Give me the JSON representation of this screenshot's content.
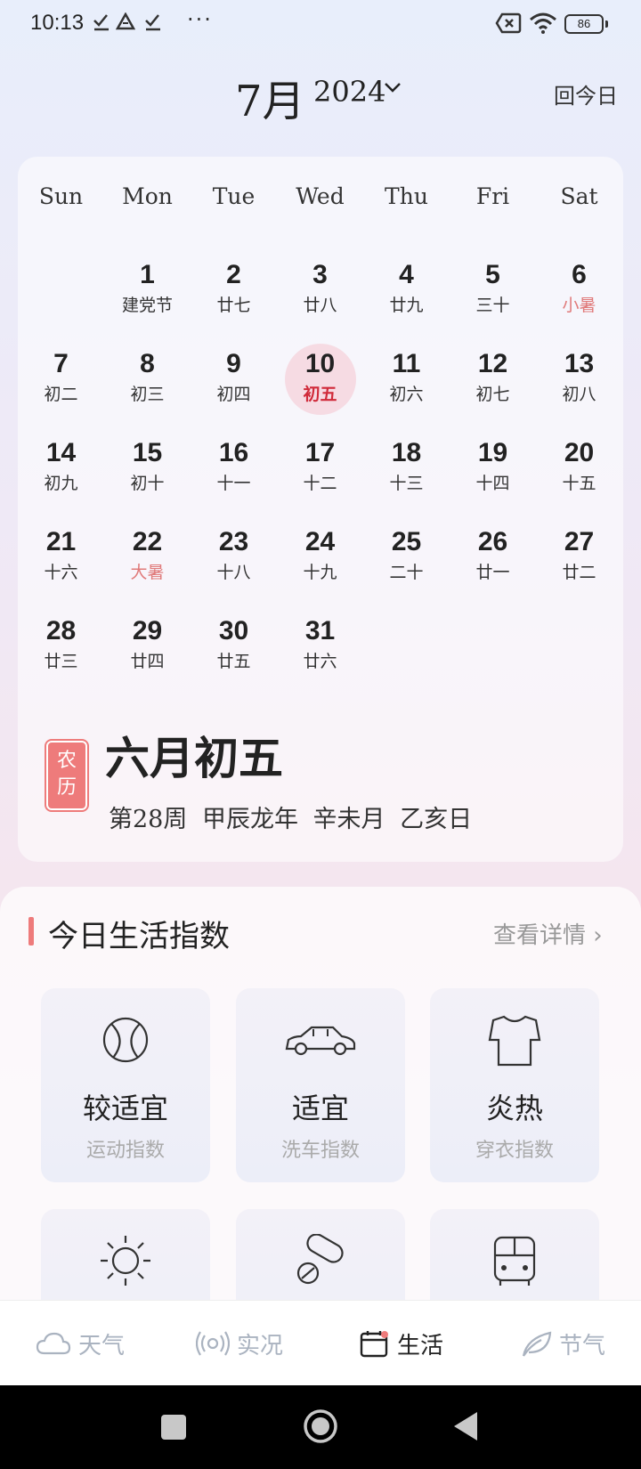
{
  "status": {
    "time": "10:13",
    "battery": "86"
  },
  "header": {
    "month": "7月",
    "year": "2024",
    "today_button": "回今日"
  },
  "calendar": {
    "weekdays": [
      "Sun",
      "Mon",
      "Tue",
      "Wed",
      "Thu",
      "Fri",
      "Sat"
    ],
    "weeks": [
      [
        null,
        {
          "day": "1",
          "lunar": "建党节",
          "festival": false
        },
        {
          "day": "2",
          "lunar": "廿七",
          "festival": false
        },
        {
          "day": "3",
          "lunar": "廿八",
          "festival": false
        },
        {
          "day": "4",
          "lunar": "廿九",
          "festival": false
        },
        {
          "day": "5",
          "lunar": "三十",
          "festival": false
        },
        {
          "day": "6",
          "lunar": "小暑",
          "festival": true
        }
      ],
      [
        {
          "day": "7",
          "lunar": "初二",
          "festival": false
        },
        {
          "day": "8",
          "lunar": "初三",
          "festival": false
        },
        {
          "day": "9",
          "lunar": "初四",
          "festival": false
        },
        {
          "day": "10",
          "lunar": "初五",
          "festival": false,
          "today": true
        },
        {
          "day": "11",
          "lunar": "初六",
          "festival": false
        },
        {
          "day": "12",
          "lunar": "初七",
          "festival": false
        },
        {
          "day": "13",
          "lunar": "初八",
          "festival": false
        }
      ],
      [
        {
          "day": "14",
          "lunar": "初九",
          "festival": false
        },
        {
          "day": "15",
          "lunar": "初十",
          "festival": false
        },
        {
          "day": "16",
          "lunar": "十一",
          "festival": false
        },
        {
          "day": "17",
          "lunar": "十二",
          "festival": false
        },
        {
          "day": "18",
          "lunar": "十三",
          "festival": false
        },
        {
          "day": "19",
          "lunar": "十四",
          "festival": false
        },
        {
          "day": "20",
          "lunar": "十五",
          "festival": false
        }
      ],
      [
        {
          "day": "21",
          "lunar": "十六",
          "festival": false
        },
        {
          "day": "22",
          "lunar": "大暑",
          "festival": true
        },
        {
          "day": "23",
          "lunar": "十八",
          "festival": false
        },
        {
          "day": "24",
          "lunar": "十九",
          "festival": false
        },
        {
          "day": "25",
          "lunar": "二十",
          "festival": false
        },
        {
          "day": "26",
          "lunar": "廿一",
          "festival": false
        },
        {
          "day": "27",
          "lunar": "廿二",
          "festival": false
        }
      ],
      [
        {
          "day": "28",
          "lunar": "廿三",
          "festival": false
        },
        {
          "day": "29",
          "lunar": "廿四",
          "festival": false
        },
        {
          "day": "30",
          "lunar": "廿五",
          "festival": false
        },
        {
          "day": "31",
          "lunar": "廿六",
          "festival": false
        },
        null,
        null,
        null
      ]
    ]
  },
  "lunar": {
    "badge": "农历",
    "date": "六月初五",
    "info": "第28周 甲辰龙年 辛未月 乙亥日"
  },
  "life_index": {
    "title": "今日生活指数",
    "more": "查看详情 ›",
    "tiles": [
      {
        "icon": "ball-icon",
        "value": "较适宜",
        "label": "运动指数"
      },
      {
        "icon": "car-icon",
        "value": "适宜",
        "label": "洗车指数"
      },
      {
        "icon": "tshirt-icon",
        "value": "炎热",
        "label": "穿衣指数"
      },
      {
        "icon": "sun-icon",
        "value": "",
        "label": ""
      },
      {
        "icon": "pill-icon",
        "value": "",
        "label": ""
      },
      {
        "icon": "bus-icon",
        "value": "",
        "label": ""
      }
    ]
  },
  "nav": {
    "weather": "天气",
    "live": "实况",
    "life": "生活",
    "solar_terms": "节气"
  },
  "colors": {
    "accent": "#ee7b7b",
    "today_bg": "#f6dbe3",
    "today_text": "#d02a3a"
  }
}
